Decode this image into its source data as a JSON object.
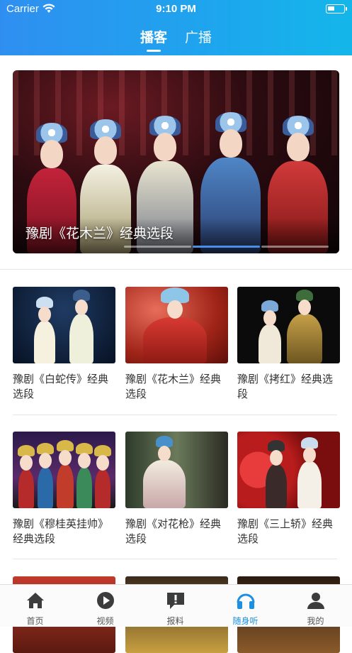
{
  "status_bar": {
    "carrier": "Carrier",
    "time": "9:10 PM"
  },
  "header_tabs": [
    {
      "label": "播客",
      "active": true
    },
    {
      "label": "广播",
      "active": false
    }
  ],
  "banner": {
    "caption": "豫剧《花木兰》经典选段",
    "page_count": 3,
    "active_page": 2
  },
  "grid": [
    [
      {
        "title": "豫剧《白蛇传》经典选段"
      },
      {
        "title": "豫剧《花木兰》经典选段"
      },
      {
        "title": "豫剧《拷红》经典选段"
      }
    ],
    [
      {
        "title": "豫剧《穆桂英挂帅》经典选段"
      },
      {
        "title": "豫剧《对花枪》经典选段"
      },
      {
        "title": "豫剧《三上轿》经典选段"
      }
    ]
  ],
  "tabbar": [
    {
      "label": "首页",
      "icon": "home-icon",
      "active": false
    },
    {
      "label": "视频",
      "icon": "play-icon",
      "active": false
    },
    {
      "label": "报料",
      "icon": "report-icon",
      "active": false
    },
    {
      "label": "随身听",
      "icon": "headphones-icon",
      "active": true
    },
    {
      "label": "我的",
      "icon": "profile-icon",
      "active": false
    }
  ],
  "colors": {
    "accent": "#1c8fe0",
    "header_start": "#2f8ff0",
    "header_end": "#14b6ea",
    "tab_inactive": "#555555"
  }
}
